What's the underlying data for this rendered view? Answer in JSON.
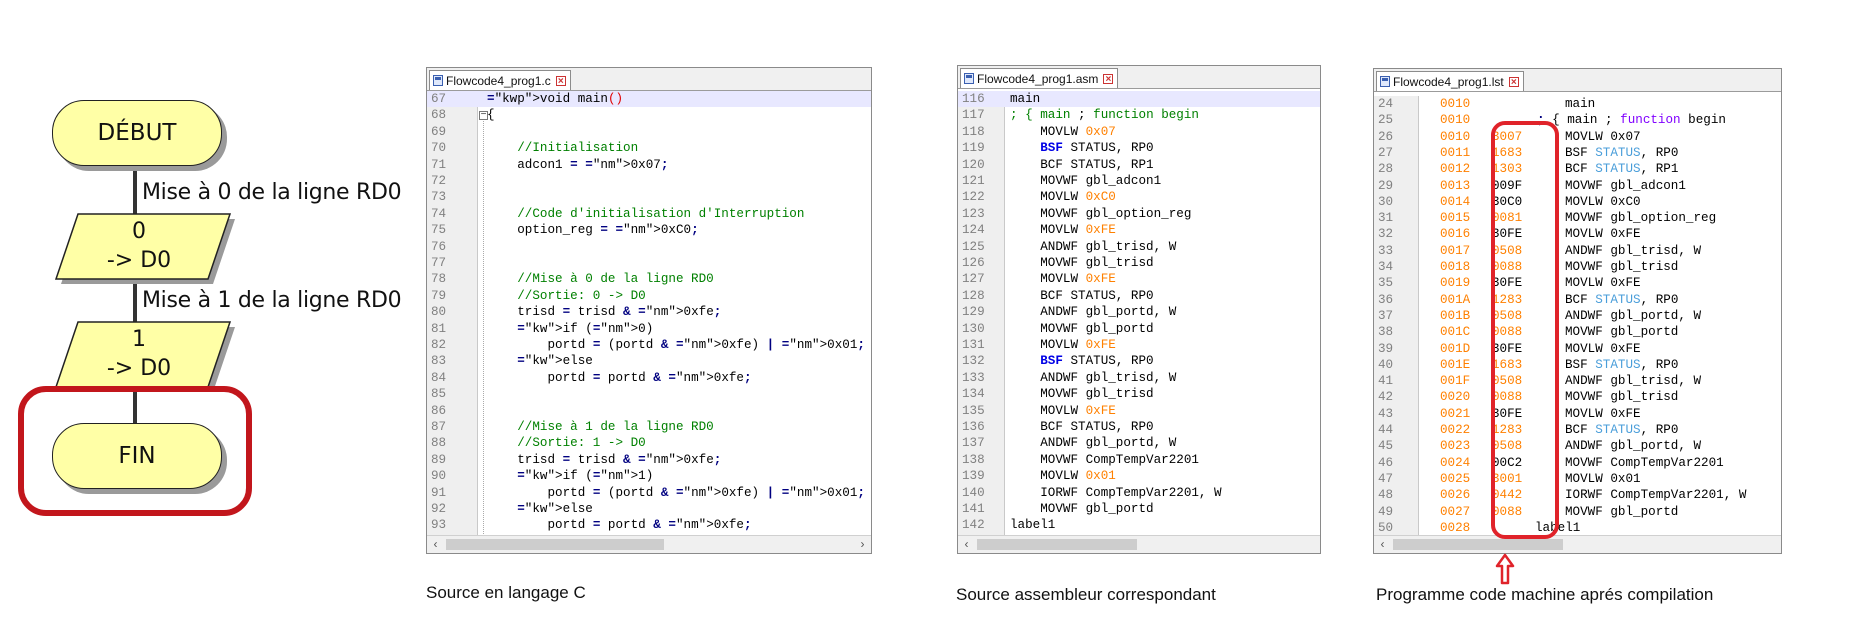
{
  "flowchart": {
    "start_label": "DÉBUT",
    "step1_label": "Mise à 0 de la ligne RD0",
    "step1_value": "0",
    "step1_target": "-> D0",
    "step2_label": "Mise à 1 de la ligne RD0",
    "step2_value": "1",
    "step2_target": "-> D0",
    "end_label": "FIN"
  },
  "editor_c": {
    "tab": "Flowcode4_prog1.c",
    "caption": "Source en langage C",
    "lines": [
      {
        "n": "67",
        "t": "void main()"
      },
      {
        "n": "68",
        "t": "{"
      },
      {
        "n": "69",
        "t": ""
      },
      {
        "n": "70",
        "t": "    //Initialisation"
      },
      {
        "n": "71",
        "t": "    adcon1 = 0x07;"
      },
      {
        "n": "72",
        "t": ""
      },
      {
        "n": "73",
        "t": ""
      },
      {
        "n": "74",
        "t": "    //Code d'initialisation d'Interruption"
      },
      {
        "n": "75",
        "t": "    option_reg = 0xC0;"
      },
      {
        "n": "76",
        "t": ""
      },
      {
        "n": "77",
        "t": ""
      },
      {
        "n": "78",
        "t": "    //Mise à 0 de la ligne RD0"
      },
      {
        "n": "79",
        "t": "    //Sortie: 0 -> D0"
      },
      {
        "n": "80",
        "t": "    trisd = trisd & 0xfe;"
      },
      {
        "n": "81",
        "t": "    if (0)"
      },
      {
        "n": "82",
        "t": "        portd = (portd & 0xfe) | 0x01;"
      },
      {
        "n": "83",
        "t": "    else"
      },
      {
        "n": "84",
        "t": "        portd = portd & 0xfe;"
      },
      {
        "n": "85",
        "t": ""
      },
      {
        "n": "86",
        "t": ""
      },
      {
        "n": "87",
        "t": "    //Mise à 1 de la ligne RD0"
      },
      {
        "n": "88",
        "t": "    //Sortie: 1 -> D0"
      },
      {
        "n": "89",
        "t": "    trisd = trisd & 0xfe;"
      },
      {
        "n": "90",
        "t": "    if (1)"
      },
      {
        "n": "91",
        "t": "        portd = (portd & 0xfe) | 0x01;"
      },
      {
        "n": "92",
        "t": "    else"
      },
      {
        "n": "93",
        "t": "        portd = portd & 0xfe;"
      }
    ]
  },
  "editor_asm": {
    "tab": "Flowcode4_prog1.asm",
    "caption": "Source assembleur correspondant",
    "lines": [
      {
        "n": "116",
        "t": "main"
      },
      {
        "n": "117",
        "t": "; { main ; function begin"
      },
      {
        "n": "118",
        "t": "    MOVLW 0x07"
      },
      {
        "n": "119",
        "t": "    BSF STATUS, RP0"
      },
      {
        "n": "120",
        "t": "    BCF STATUS, RP1"
      },
      {
        "n": "121",
        "t": "    MOVWF gbl_adcon1"
      },
      {
        "n": "122",
        "t": "    MOVLW 0xC0"
      },
      {
        "n": "123",
        "t": "    MOVWF gbl_option_reg"
      },
      {
        "n": "124",
        "t": "    MOVLW 0xFE"
      },
      {
        "n": "125",
        "t": "    ANDWF gbl_trisd, W"
      },
      {
        "n": "126",
        "t": "    MOVWF gbl_trisd"
      },
      {
        "n": "127",
        "t": "    MOVLW 0xFE"
      },
      {
        "n": "128",
        "t": "    BCF STATUS, RP0"
      },
      {
        "n": "129",
        "t": "    ANDWF gbl_portd, W"
      },
      {
        "n": "130",
        "t": "    MOVWF gbl_portd"
      },
      {
        "n": "131",
        "t": "    MOVLW 0xFE"
      },
      {
        "n": "132",
        "t": "    BSF STATUS, RP0"
      },
      {
        "n": "133",
        "t": "    ANDWF gbl_trisd, W"
      },
      {
        "n": "134",
        "t": "    MOVWF gbl_trisd"
      },
      {
        "n": "135",
        "t": "    MOVLW 0xFE"
      },
      {
        "n": "136",
        "t": "    BCF STATUS, RP0"
      },
      {
        "n": "137",
        "t": "    ANDWF gbl_portd, W"
      },
      {
        "n": "138",
        "t": "    MOVWF CompTempVar2201"
      },
      {
        "n": "139",
        "t": "    MOVLW 0x01"
      },
      {
        "n": "140",
        "t": "    IORWF CompTempVar2201, W"
      },
      {
        "n": "141",
        "t": "    MOVWF gbl_portd"
      },
      {
        "n": "142",
        "t": "label1"
      }
    ]
  },
  "editor_lst": {
    "tab": "Flowcode4_prog1.lst",
    "caption": "Programme code machine aprés compilation",
    "lines": [
      {
        "n": "24",
        "a": "0010",
        "m": "",
        "t": "main"
      },
      {
        "n": "25",
        "a": "0010",
        "m": "",
        "t": "; { main ; function begin"
      },
      {
        "n": "26",
        "a": "0010",
        "m": "3007",
        "t": "MOVLW 0x07"
      },
      {
        "n": "27",
        "a": "0011",
        "m": "1683",
        "t": "BSF STATUS, RP0"
      },
      {
        "n": "28",
        "a": "0012",
        "m": "1303",
        "t": "BCF STATUS, RP1"
      },
      {
        "n": "29",
        "a": "0013",
        "m": "009F",
        "t": "MOVWF gbl_adcon1"
      },
      {
        "n": "30",
        "a": "0014",
        "m": "30C0",
        "t": "MOVLW 0xC0"
      },
      {
        "n": "31",
        "a": "0015",
        "m": "0081",
        "t": "MOVWF gbl_option_reg"
      },
      {
        "n": "32",
        "a": "0016",
        "m": "30FE",
        "t": "MOVLW 0xFE"
      },
      {
        "n": "33",
        "a": "0017",
        "m": "0508",
        "t": "ANDWF gbl_trisd, W"
      },
      {
        "n": "34",
        "a": "0018",
        "m": "0088",
        "t": "MOVWF gbl_trisd"
      },
      {
        "n": "35",
        "a": "0019",
        "m": "30FE",
        "t": "MOVLW 0xFE"
      },
      {
        "n": "36",
        "a": "001A",
        "m": "1283",
        "t": "BCF STATUS, RP0"
      },
      {
        "n": "37",
        "a": "001B",
        "m": "0508",
        "t": "ANDWF gbl_portd, W"
      },
      {
        "n": "38",
        "a": "001C",
        "m": "0088",
        "t": "MOVWF gbl_portd"
      },
      {
        "n": "39",
        "a": "001D",
        "m": "30FE",
        "t": "MOVLW 0xFE"
      },
      {
        "n": "40",
        "a": "001E",
        "m": "1683",
        "t": "BSF STATUS, RP0"
      },
      {
        "n": "41",
        "a": "001F",
        "m": "0508",
        "t": "ANDWF gbl_trisd, W"
      },
      {
        "n": "42",
        "a": "0020",
        "m": "0088",
        "t": "MOVWF gbl_trisd"
      },
      {
        "n": "43",
        "a": "0021",
        "m": "30FE",
        "t": "MOVLW 0xFE"
      },
      {
        "n": "44",
        "a": "0022",
        "m": "1283",
        "t": "BCF STATUS, RP0"
      },
      {
        "n": "45",
        "a": "0023",
        "m": "0508",
        "t": "ANDWF gbl_portd, W"
      },
      {
        "n": "46",
        "a": "0024",
        "m": "00C2",
        "t": "MOVWF CompTempVar2201"
      },
      {
        "n": "47",
        "a": "0025",
        "m": "3001",
        "t": "MOVLW 0x01"
      },
      {
        "n": "48",
        "a": "0026",
        "m": "0442",
        "t": "IORWF CompTempVar2201, W"
      },
      {
        "n": "49",
        "a": "0027",
        "m": "0088",
        "t": "MOVWF gbl_portd"
      },
      {
        "n": "50",
        "a": "0028",
        "m": "",
        "t": "label1"
      }
    ]
  },
  "colors": {
    "terminal_fill": "#ffffa6",
    "highlight_red": "#c2161c",
    "keyword_blue": "#0000e6",
    "comment_green": "#008000",
    "number_orange": "#ff8000"
  }
}
